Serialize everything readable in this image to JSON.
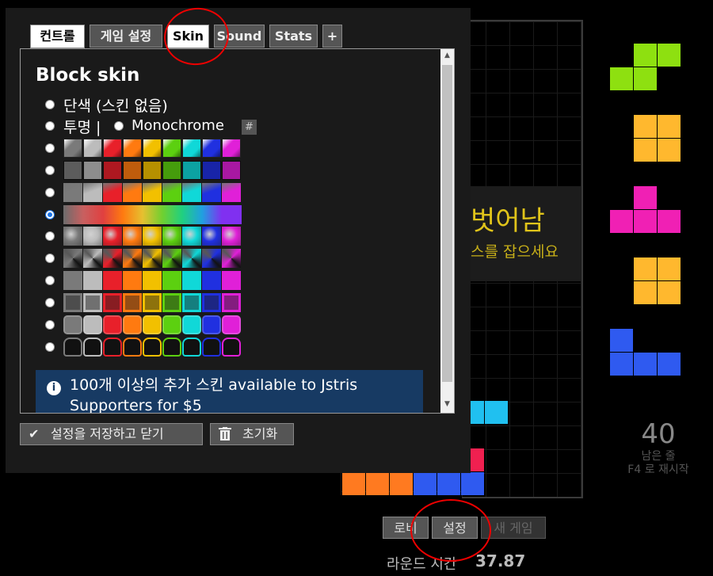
{
  "tabs": [
    {
      "label": "컨트롤",
      "active": true
    },
    {
      "label": "게임 설정",
      "active": false
    },
    {
      "label": "Skin",
      "active": false
    },
    {
      "label": "Sound",
      "active": false
    },
    {
      "label": "Stats",
      "active": false
    },
    {
      "label": "+",
      "active": false
    }
  ],
  "panel": {
    "heading": "Block skin",
    "opt_solid": "단색 (스킨 없음)",
    "opt_transparent": "투명 |",
    "opt_mono": "Monochrome",
    "hash": "#",
    "selected_skin_row": 4,
    "info_icon": "i",
    "info_text": "100개 이상의 추가 스킨 available to Jstris Supporters for $5"
  },
  "buttons": {
    "save_close": "설정을 저장하고 닫기",
    "reset": "초기화",
    "lobby": "로비",
    "settings": "설정",
    "new_game": "새 게임"
  },
  "game": {
    "overlay_title": "벗어남",
    "overlay_sub": "스를 잡으세요",
    "lines_left": "40",
    "lines_label": "남은 줄",
    "restart_hint": "F4 로 재시작",
    "round_label": "라운드 시간",
    "round_value": "37.87"
  },
  "colors": {
    "accent_blue": "#1a73e8",
    "info_bg": "#173a63",
    "overlay_yellow": "#e0c41a",
    "piece_green": "#8ee010",
    "piece_yellow": "#ffb82e",
    "piece_magenta": "#f020b4",
    "piece_blue": "#2f5af0",
    "piece_cyan": "#20c0f0",
    "piece_orange": "#ff7a20",
    "piece_red": "#f02050"
  }
}
